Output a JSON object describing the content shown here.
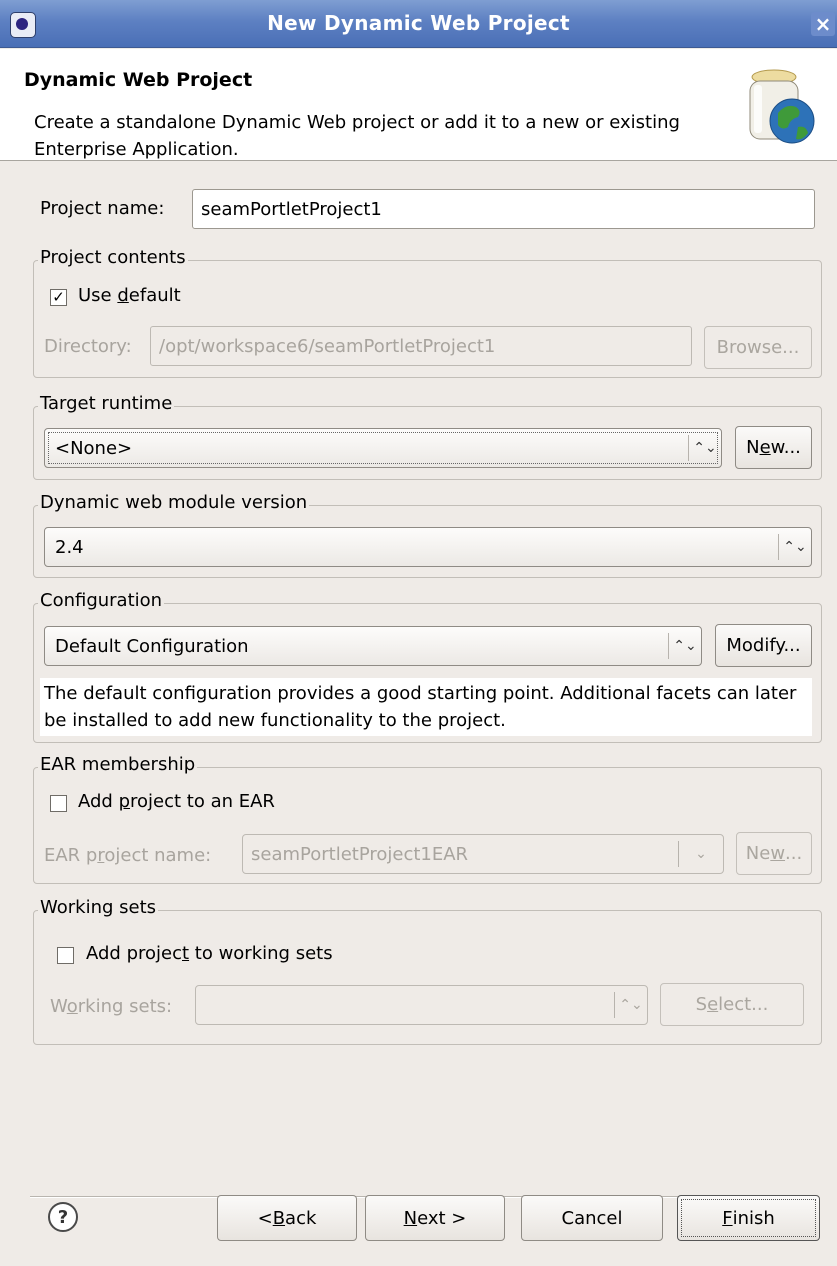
{
  "window": {
    "title": "New Dynamic Web Project",
    "close_glyph": "×"
  },
  "banner": {
    "heading": "Dynamic Web Project",
    "description": "Create a standalone Dynamic Web project or add it to a new or existing Enterprise Application."
  },
  "project_name": {
    "label": "Project name:",
    "value": "seamPortletProject1"
  },
  "project_contents": {
    "legend": "Project contents",
    "use_default": {
      "label": "Use default",
      "checked": true
    },
    "directory": {
      "label": "Directory:",
      "value": "/opt/workspace6/seamPortletProject1",
      "browse": "Browse..."
    }
  },
  "target_runtime": {
    "legend": "Target runtime",
    "selected": "<None>",
    "new_button": "New..."
  },
  "web_module": {
    "legend": "Dynamic web module version",
    "selected": "2.4"
  },
  "configuration": {
    "legend": "Configuration",
    "selected": "Default Configuration",
    "modify_button": "Modify...",
    "description": "The default configuration provides a good starting point. Additional facets can later be installed to add new functionality to the project."
  },
  "ear": {
    "legend": "EAR membership",
    "add_label": "Add project to an EAR",
    "checked": false,
    "project_label": "EAR project name:",
    "project_value": "seamPortletProject1EAR",
    "new_button": "New..."
  },
  "working_sets": {
    "legend": "Working sets",
    "add_label": "Add project to working sets",
    "checked": false,
    "sets_label": "Working sets:",
    "sets_value": "",
    "select_button": "Select..."
  },
  "footer": {
    "help_glyph": "?",
    "back": "< Back",
    "next": "Next >",
    "cancel": "Cancel",
    "finish": "Finish"
  },
  "icons": {
    "up_down": "⌃⌄",
    "dropdown": "⌄",
    "check": "✓"
  }
}
